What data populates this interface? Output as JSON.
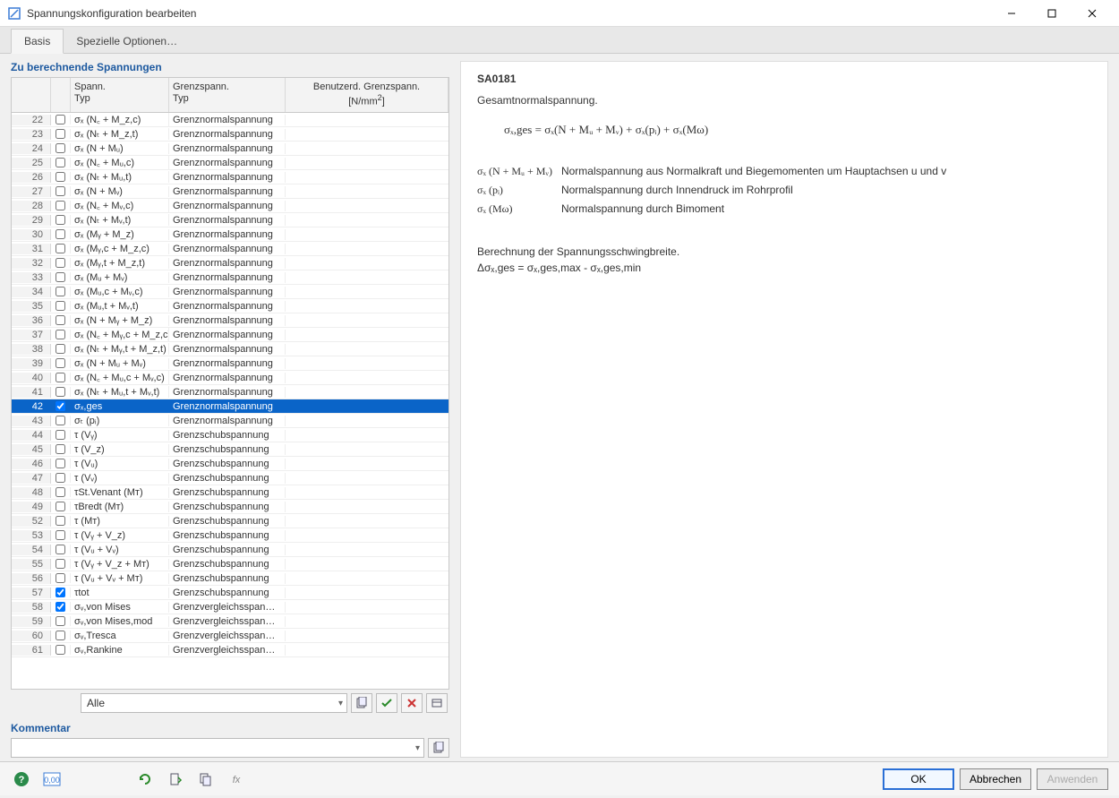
{
  "window": {
    "title": "Spannungskonfiguration bearbeiten"
  },
  "tabs": {
    "basis": "Basis",
    "special": "Spezielle Optionen…"
  },
  "left": {
    "title": "Zu berechnende Spannungen",
    "headers": {
      "type": "Spann.\nTyp",
      "limit": "Grenzspann.\nTyp",
      "user": "Benutzerd. Grenzspann.\n[N/mm²]"
    },
    "rows": [
      {
        "n": 22,
        "chk": false,
        "type": "σₓ (N꜀ + M_z,c)",
        "limit": "Grenznormalspannung"
      },
      {
        "n": 23,
        "chk": false,
        "type": "σₓ (Nₜ + M_z,t)",
        "limit": "Grenznormalspannung"
      },
      {
        "n": 24,
        "chk": false,
        "type": "σₓ (N + Mᵤ)",
        "limit": "Grenznormalspannung"
      },
      {
        "n": 25,
        "chk": false,
        "type": "σₓ (N꜀ + Mᵤ,c)",
        "limit": "Grenznormalspannung"
      },
      {
        "n": 26,
        "chk": false,
        "type": "σₓ (Nₜ + Mᵤ,t)",
        "limit": "Grenznormalspannung"
      },
      {
        "n": 27,
        "chk": false,
        "type": "σₓ (N + Mᵥ)",
        "limit": "Grenznormalspannung"
      },
      {
        "n": 28,
        "chk": false,
        "type": "σₓ (N꜀ + Mᵥ,c)",
        "limit": "Grenznormalspannung"
      },
      {
        "n": 29,
        "chk": false,
        "type": "σₓ (Nₜ + Mᵥ,t)",
        "limit": "Grenznormalspannung"
      },
      {
        "n": 30,
        "chk": false,
        "type": "σₓ (Mᵧ + M_z)",
        "limit": "Grenznormalspannung"
      },
      {
        "n": 31,
        "chk": false,
        "type": "σₓ (Mᵧ,c + M_z,c)",
        "limit": "Grenznormalspannung"
      },
      {
        "n": 32,
        "chk": false,
        "type": "σₓ (Mᵧ,t + M_z,t)",
        "limit": "Grenznormalspannung"
      },
      {
        "n": 33,
        "chk": false,
        "type": "σₓ (Mᵤ + Mᵥ)",
        "limit": "Grenznormalspannung"
      },
      {
        "n": 34,
        "chk": false,
        "type": "σₓ (Mᵤ,c + Mᵥ,c)",
        "limit": "Grenznormalspannung"
      },
      {
        "n": 35,
        "chk": false,
        "type": "σₓ (Mᵤ,t + Mᵥ,t)",
        "limit": "Grenznormalspannung"
      },
      {
        "n": 36,
        "chk": false,
        "type": "σₓ (N + Mᵧ + M_z)",
        "limit": "Grenznormalspannung"
      },
      {
        "n": 37,
        "chk": false,
        "type": "σₓ (N꜀ + Mᵧ,c + M_z,c)",
        "limit": "Grenznormalspannung"
      },
      {
        "n": 38,
        "chk": false,
        "type": "σₓ (Nₜ + Mᵧ,t + M_z,t)",
        "limit": "Grenznormalspannung"
      },
      {
        "n": 39,
        "chk": false,
        "type": "σₓ (N + Mᵤ + Mᵥ)",
        "limit": "Grenznormalspannung"
      },
      {
        "n": 40,
        "chk": false,
        "type": "σₓ (N꜀ + Mᵤ,c + Mᵥ,c)",
        "limit": "Grenznormalspannung"
      },
      {
        "n": 41,
        "chk": false,
        "type": "σₓ (Nₜ + Mᵤ,t + Mᵥ,t)",
        "limit": "Grenznormalspannung"
      },
      {
        "n": 42,
        "chk": true,
        "type": "σₓ,ges",
        "limit": "Grenznormalspannung",
        "selected": true
      },
      {
        "n": 43,
        "chk": false,
        "type": "σₜ (pᵢ)",
        "limit": "Grenznormalspannung"
      },
      {
        "n": 44,
        "chk": false,
        "type": "τ (Vᵧ)",
        "limit": "Grenzschubspannung"
      },
      {
        "n": 45,
        "chk": false,
        "type": "τ (V_z)",
        "limit": "Grenzschubspannung"
      },
      {
        "n": 46,
        "chk": false,
        "type": "τ (Vᵤ)",
        "limit": "Grenzschubspannung"
      },
      {
        "n": 47,
        "chk": false,
        "type": "τ (Vᵥ)",
        "limit": "Grenzschubspannung"
      },
      {
        "n": 48,
        "chk": false,
        "type": "τSt.Venant (Mᴛ)",
        "limit": "Grenzschubspannung"
      },
      {
        "n": 49,
        "chk": false,
        "type": "τBredt (Mᴛ)",
        "limit": "Grenzschubspannung"
      },
      {
        "n": 52,
        "chk": false,
        "type": "τ (Mᴛ)",
        "limit": "Grenzschubspannung"
      },
      {
        "n": 53,
        "chk": false,
        "type": "τ (Vᵧ + V_z)",
        "limit": "Grenzschubspannung"
      },
      {
        "n": 54,
        "chk": false,
        "type": "τ (Vᵤ + Vᵥ)",
        "limit": "Grenzschubspannung"
      },
      {
        "n": 55,
        "chk": false,
        "type": "τ (Vᵧ + V_z + Mᴛ)",
        "limit": "Grenzschubspannung"
      },
      {
        "n": 56,
        "chk": false,
        "type": "τ (Vᵤ + Vᵥ + Mᴛ)",
        "limit": "Grenzschubspannung"
      },
      {
        "n": 57,
        "chk": true,
        "type": "τtot",
        "limit": "Grenzschubspannung"
      },
      {
        "n": 58,
        "chk": true,
        "type": "σᵥ,von Mises",
        "limit": "Grenzvergleichsspan…"
      },
      {
        "n": 59,
        "chk": false,
        "type": "σᵥ,von Mises,mod",
        "limit": "Grenzvergleichsspan…"
      },
      {
        "n": 60,
        "chk": false,
        "type": "σᵥ,Tresca",
        "limit": "Grenzvergleichsspan…"
      },
      {
        "n": 61,
        "chk": false,
        "type": "σᵥ,Rankine",
        "limit": "Grenzvergleichsspan…"
      }
    ],
    "filter": "Alle",
    "komment_title": "Kommentar"
  },
  "right": {
    "code": "SA0181",
    "desc": "Gesamtnormalspannung.",
    "formula": "σₓ,ges = σₓ(N + Mᵤ + Mᵥ) + σₓ(pᵢ) + σₓ(Mω)",
    "defs": [
      {
        "sym": "σₓ (N + Mᵤ + Mᵥ)",
        "txt": "Normalspannung aus Normalkraft und Biegemomenten um Hauptachsen u und v"
      },
      {
        "sym": "σₓ (pᵢ)",
        "txt": "Normalspannung durch Innendruck im Rohrprofil"
      },
      {
        "sym": "σₓ (Mω)",
        "txt": "Normalspannung durch Bimoment"
      }
    ],
    "swing1": "Berechnung der Spannungsschwingbreite.",
    "swing2": "Δσₓ,ges = σₓ,ges,max - σₓ,ges,min"
  },
  "footer": {
    "ok": "OK",
    "cancel": "Abbrechen",
    "apply": "Anwenden"
  }
}
